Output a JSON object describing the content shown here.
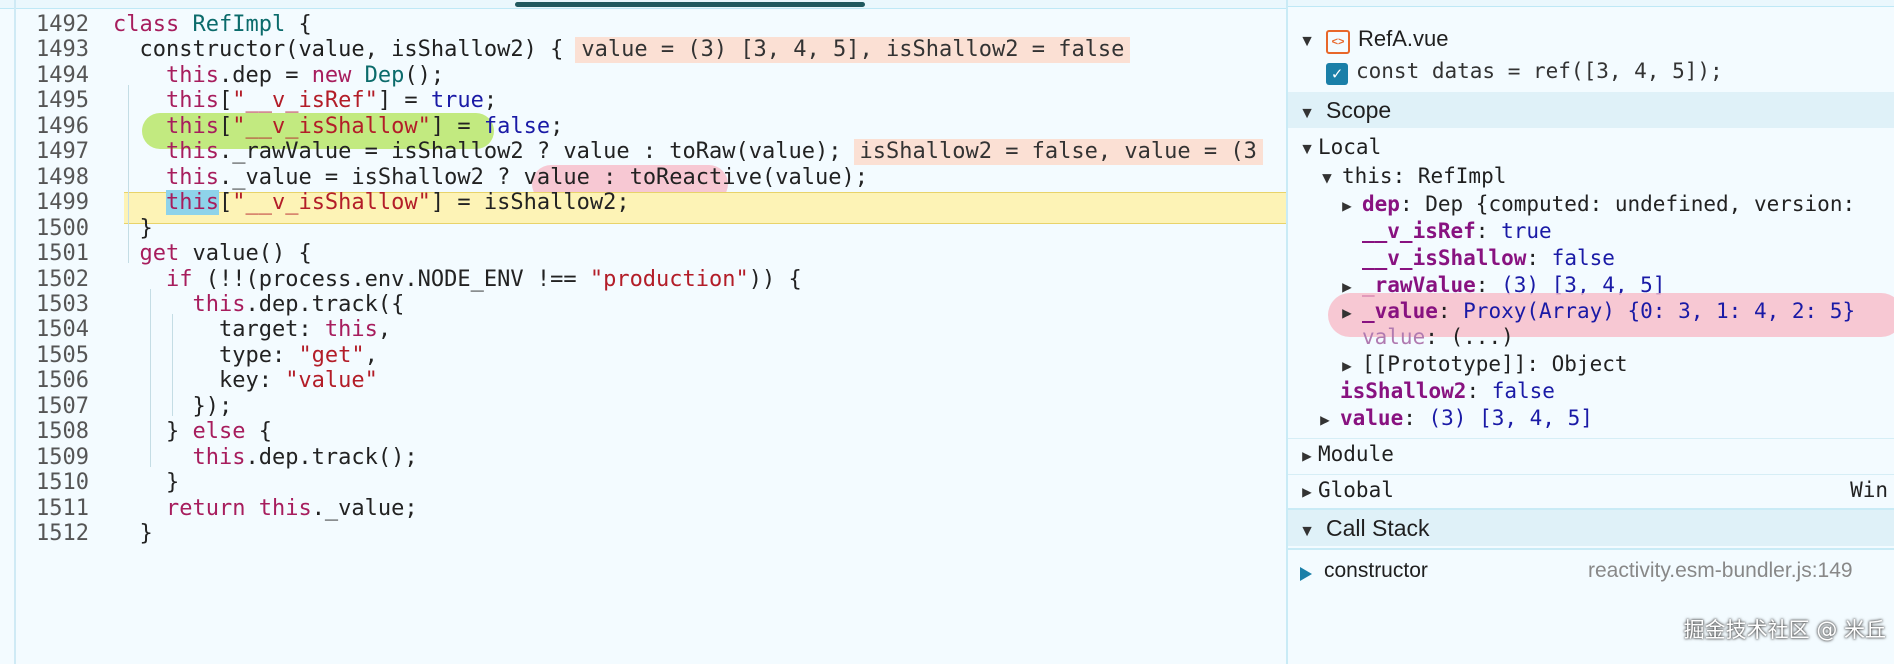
{
  "editor": {
    "lines": [
      {
        "no": "1492",
        "tokens": [
          {
            "t": "class ",
            "c": "kw"
          },
          {
            "t": "RefImpl",
            "c": "cls"
          },
          {
            "t": " {",
            "c": "plain"
          }
        ]
      },
      {
        "no": "1493",
        "tokens": [
          {
            "t": "  constructor(",
            "c": "plain"
          },
          {
            "t": "value",
            "c": "prm"
          },
          {
            "t": ", ",
            "c": "plain"
          },
          {
            "t": "isShallow2",
            "c": "prm"
          },
          {
            "t": ") {",
            "c": "plain"
          }
        ],
        "inline": "value = (3) [3, 4, 5], isShallow2 = false"
      },
      {
        "no": "1494",
        "tokens": [
          {
            "t": "    this",
            "c": "kw"
          },
          {
            "t": ".dep = ",
            "c": "plain"
          },
          {
            "t": "new ",
            "c": "kw"
          },
          {
            "t": "Dep",
            "c": "cls"
          },
          {
            "t": "();",
            "c": "plain"
          }
        ]
      },
      {
        "no": "1495",
        "tokens": [
          {
            "t": "    this",
            "c": "kw"
          },
          {
            "t": "[",
            "c": "plain"
          },
          {
            "t": "\"__v_isRef\"",
            "c": "str"
          },
          {
            "t": "] = ",
            "c": "plain"
          },
          {
            "t": "true",
            "c": "kw2"
          },
          {
            "t": ";",
            "c": "plain"
          }
        ]
      },
      {
        "no": "1496",
        "tokens": [
          {
            "t": "    this",
            "c": "kw"
          },
          {
            "t": "[",
            "c": "plain"
          },
          {
            "t": "\"__v_isShallow\"",
            "c": "str"
          },
          {
            "t": "] = ",
            "c": "plain"
          },
          {
            "t": "false",
            "c": "kw2"
          },
          {
            "t": ";",
            "c": "plain"
          }
        ]
      },
      {
        "no": "1497",
        "tokens": [
          {
            "t": "    this",
            "c": "kw"
          },
          {
            "t": "._rawValue = isShallow2 ? value : toRaw(value);",
            "c": "plain"
          }
        ],
        "inline": "isShallow2 = false, value = (3"
      },
      {
        "no": "1498",
        "tokens": [
          {
            "t": "    this",
            "c": "kw"
          },
          {
            "t": "._value = isShallow2 ? value : toReactive(value);",
            "c": "plain"
          }
        ]
      },
      {
        "no": "1499",
        "tokens": [
          {
            "t": "    this",
            "c": "kw"
          },
          {
            "t": "[",
            "c": "plain"
          },
          {
            "t": "\"__v_isShallow\"",
            "c": "str"
          },
          {
            "t": "] = isShallow2;",
            "c": "plain"
          }
        ]
      },
      {
        "no": "1500",
        "tokens": [
          {
            "t": "  }",
            "c": "plain"
          }
        ]
      },
      {
        "no": "1501",
        "tokens": [
          {
            "t": "  get ",
            "c": "kw"
          },
          {
            "t": "value() {",
            "c": "plain"
          }
        ]
      },
      {
        "no": "1502",
        "tokens": [
          {
            "t": "    if ",
            "c": "kw"
          },
          {
            "t": "(!!(process.env.NODE_ENV !== ",
            "c": "plain"
          },
          {
            "t": "\"production\"",
            "c": "str"
          },
          {
            "t": ")) {",
            "c": "plain"
          }
        ]
      },
      {
        "no": "1503",
        "tokens": [
          {
            "t": "      this",
            "c": "kw"
          },
          {
            "t": ".dep.track({",
            "c": "plain"
          }
        ]
      },
      {
        "no": "1504",
        "tokens": [
          {
            "t": "        target: ",
            "c": "plain"
          },
          {
            "t": "this",
            "c": "kw"
          },
          {
            "t": ",",
            "c": "plain"
          }
        ]
      },
      {
        "no": "1505",
        "tokens": [
          {
            "t": "        type: ",
            "c": "plain"
          },
          {
            "t": "\"get\"",
            "c": "str"
          },
          {
            "t": ",",
            "c": "plain"
          }
        ]
      },
      {
        "no": "1506",
        "tokens": [
          {
            "t": "        key: ",
            "c": "plain"
          },
          {
            "t": "\"value\"",
            "c": "str"
          }
        ]
      },
      {
        "no": "1507",
        "tokens": [
          {
            "t": "      });",
            "c": "plain"
          }
        ]
      },
      {
        "no": "1508",
        "tokens": [
          {
            "t": "    } ",
            "c": "plain"
          },
          {
            "t": "else ",
            "c": "kw"
          },
          {
            "t": "{",
            "c": "plain"
          }
        ]
      },
      {
        "no": "1509",
        "tokens": [
          {
            "t": "      this",
            "c": "kw"
          },
          {
            "t": ".dep.track();",
            "c": "plain"
          }
        ]
      },
      {
        "no": "1510",
        "tokens": [
          {
            "t": "    }",
            "c": "plain"
          }
        ]
      },
      {
        "no": "1511",
        "tokens": [
          {
            "t": "    return ",
            "c": "kw"
          },
          {
            "t": "this",
            "c": "kw"
          },
          {
            "t": "._value;",
            "c": "plain"
          }
        ]
      },
      {
        "no": "1512",
        "tokens": [
          {
            "t": "  }",
            "c": "plain"
          }
        ]
      }
    ]
  },
  "panel": {
    "breakpoints": {
      "file": "RefA.vue",
      "file_icon": "vue-file-icon",
      "checked_line": "const datas = ref([3, 4, 5]);"
    },
    "scope_label": "Scope",
    "local_label": "Local",
    "this_label": "this: RefImpl",
    "items": {
      "dep_key": "dep",
      "dep_val": "Dep {computed: undefined, version:",
      "isref_key": "__v_isRef",
      "isref_val": "true",
      "isshallow_key": "__v_isShallow",
      "isshallow_val": "false",
      "raw_key": "_rawValue",
      "raw_val": "(3) [3, 4, 5]",
      "value_key": "_value",
      "value_val": "Proxy(Array) {0: 3, 1: 4, 2: 5}",
      "getter_key": "value",
      "getter_val": "(...)",
      "proto": "[[Prototype]]: Object",
      "shallow2_key": "isShallow2",
      "shallow2_val": "false",
      "valueparam_key": "value",
      "valueparam_val": "(3) [3, 4, 5]"
    },
    "module_label": "Module",
    "global_label": "Global",
    "global_val": "Win",
    "callstack_label": "Call Stack",
    "callstack_first": "constructor",
    "callstack_file": "reactivity.esm-bundler.js:149"
  },
  "watermark": "掘金技术社区 @ 米丘",
  "colors": {
    "highlight_green": "#b8e66a",
    "highlight_pink": "#f7bcc8",
    "exec_line": "#fdf3b6"
  }
}
